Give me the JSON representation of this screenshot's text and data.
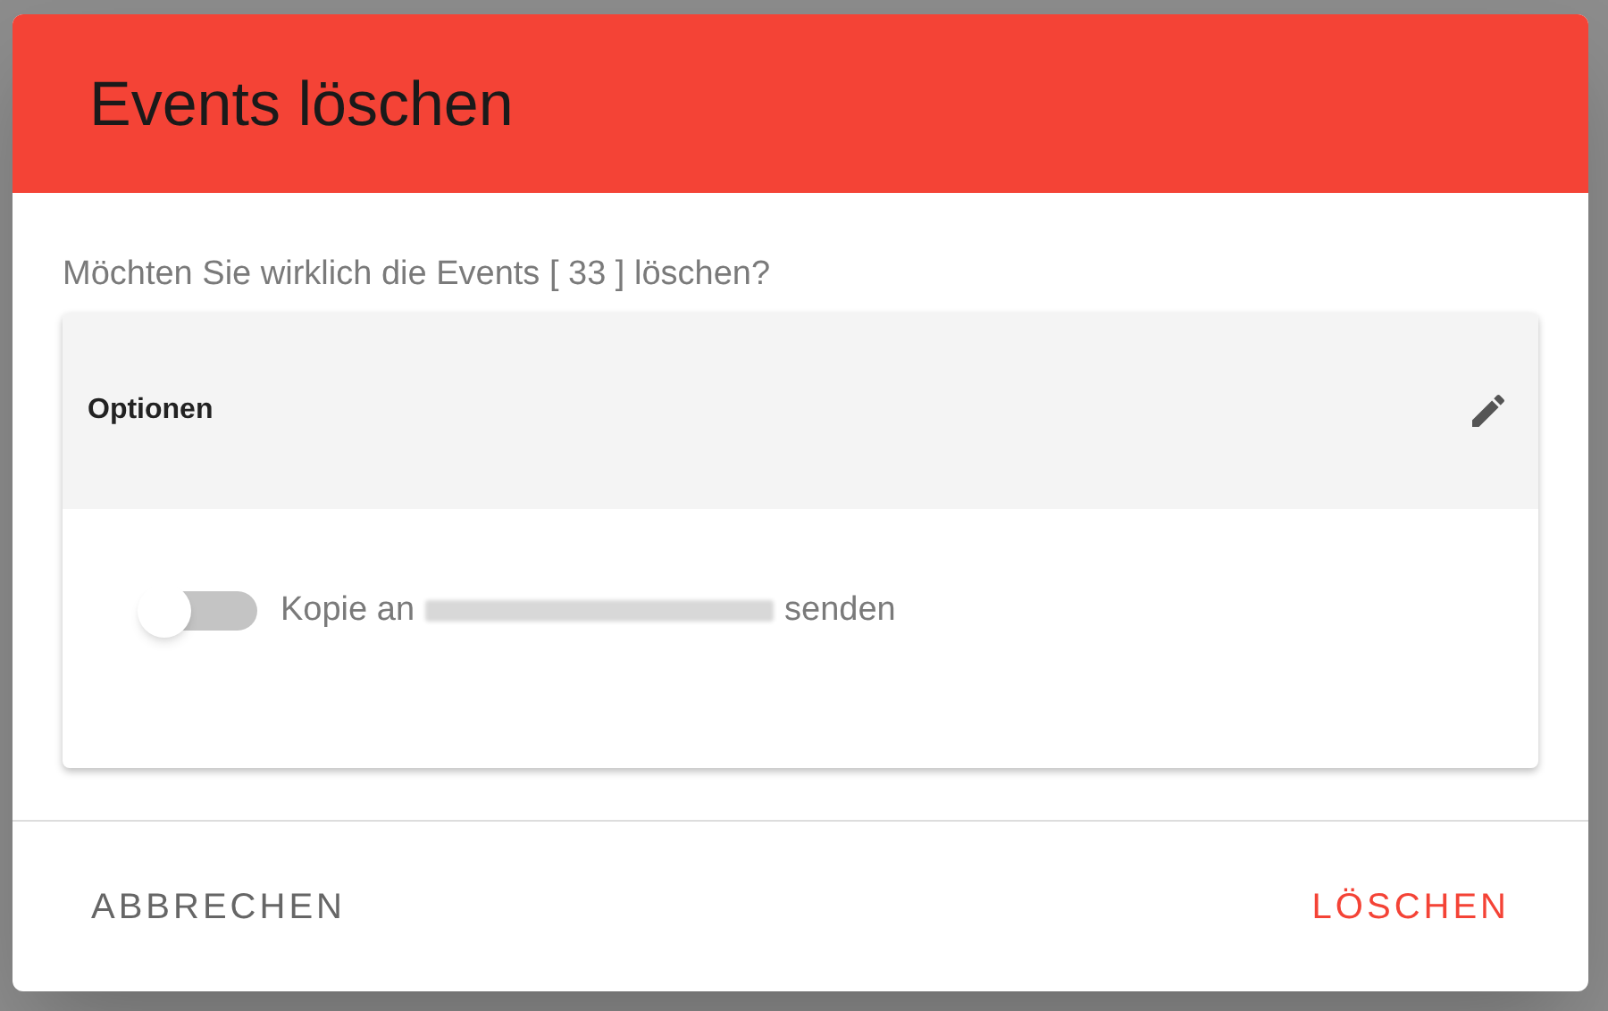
{
  "dialog": {
    "title": "Events löschen",
    "message": "Möchten Sie wirklich die Events [ 33 ] löschen?",
    "panel": {
      "title": "Optionen",
      "options": [
        {
          "kind": "toggle",
          "on": false,
          "label_before": "Kopie an",
          "label_after": "senden"
        }
      ]
    },
    "buttons": [
      {
        "kind": "cancel",
        "label": "ABBRECHEN"
      },
      {
        "kind": "confirm",
        "label": "LÖSCHEN"
      }
    ]
  }
}
